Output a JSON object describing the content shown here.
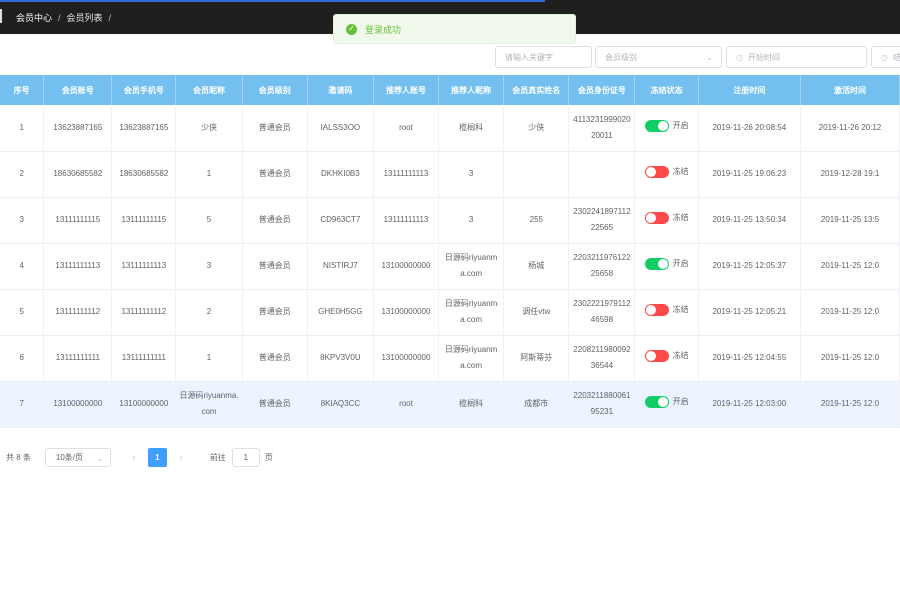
{
  "breadcrumb": {
    "items": [
      "会员中心",
      "会员列表"
    ],
    "separator": "/"
  },
  "toast": {
    "message": "登录成功",
    "icon": "check-circle-icon",
    "color": "#67c23a"
  },
  "filters": {
    "keyword_placeholder": "请输入关键字",
    "level_placeholder": "会员级别",
    "start_placeholder": "开始时间",
    "end_placeholder": "结"
  },
  "table": {
    "header_color": "#73bff0",
    "columns": [
      "序号",
      "会员账号",
      "会员手机号",
      "会员昵称",
      "会员级别",
      "邀请码",
      "推荐人账号",
      "推荐人昵称",
      "会员真实姓名",
      "会员身份证号",
      "冻结状态",
      "注册时间",
      "激活时间"
    ],
    "rows": [
      {
        "no": "1",
        "account": "13623887165",
        "phone": "13623887165",
        "nickname": "少侠",
        "level": "普通会员",
        "invite": "IALSS3OO",
        "ref_account": "root",
        "ref_nick": "榄榈科",
        "real_name": "少侠",
        "id_card": "411323199902020011",
        "status_on": true,
        "status_label": "开启",
        "reg_time": "2019-11-26 20:08:54",
        "act_time": "2019-11-26 20:12"
      },
      {
        "no": "2",
        "account": "18630685582",
        "phone": "18630685582",
        "nickname": "1",
        "level": "普通会员",
        "invite": "DKHKI0B3",
        "ref_account": "13111111113",
        "ref_nick": "3",
        "real_name": "",
        "id_card": "",
        "status_on": false,
        "status_label": "冻结",
        "reg_time": "2019-11-25 19:06:23",
        "act_time": "2019-12-28 19:1"
      },
      {
        "no": "3",
        "account": "13111111115",
        "phone": "13111111115",
        "nickname": "5",
        "level": "普通会员",
        "invite": "CD963CT7",
        "ref_account": "13111111113",
        "ref_nick": "3",
        "real_name": "255",
        "id_card": "230224189711222565",
        "status_on": false,
        "status_label": "冻结",
        "reg_time": "2019-11-25 13:50:34",
        "act_time": "2019-11-25 13:5"
      },
      {
        "no": "4",
        "account": "13111111113",
        "phone": "13111111113",
        "nickname": "3",
        "level": "普通会员",
        "invite": "NISTIRJ7",
        "ref_account": "13100000000",
        "ref_nick": "日源码riyuanma.com",
        "real_name": "杨城",
        "id_card": "220321197612225658",
        "status_on": true,
        "status_label": "开启",
        "reg_time": "2019-11-25 12:05:37",
        "act_time": "2019-11-25 12:0"
      },
      {
        "no": "5",
        "account": "13111111112",
        "phone": "13111111112",
        "nickname": "2",
        "level": "普通会员",
        "invite": "GHE0H5GG",
        "ref_account": "13100000000",
        "ref_nick": "日源码riyuanma.com",
        "real_name": "调任vtw",
        "id_card": "230222197911246598",
        "status_on": false,
        "status_label": "冻结",
        "reg_time": "2019-11-25 12:05:21",
        "act_time": "2019-11-25 12:0"
      },
      {
        "no": "6",
        "account": "13111111111",
        "phone": "13111111111",
        "nickname": "1",
        "level": "普通会员",
        "invite": "8KPV3V0U",
        "ref_account": "13100000000",
        "ref_nick": "日源码riyuanma.com",
        "real_name": "阿斯蒂芬",
        "id_card": "220821198009236544",
        "status_on": false,
        "status_label": "冻结",
        "reg_time": "2019-11-25 12:04:55",
        "act_time": "2019-11-25 12:0"
      },
      {
        "no": "7",
        "account": "13100000000",
        "phone": "13100000000",
        "nickname": "日源码riyuanma.com",
        "level": "普通会员",
        "invite": "8KIAQ3CC",
        "ref_account": "root",
        "ref_nick": "榄榈科",
        "real_name": "成都市",
        "id_card": "220321188006195231",
        "status_on": true,
        "status_label": "开启",
        "reg_time": "2019-11-25 12:03:00",
        "act_time": "2019-11-25 12:0"
      }
    ]
  },
  "pagination": {
    "total_text": "共 8 条",
    "page_size": "10条/页",
    "current_page": "1",
    "goto_label": "前往",
    "goto_value": "1",
    "goto_unit": "页"
  }
}
